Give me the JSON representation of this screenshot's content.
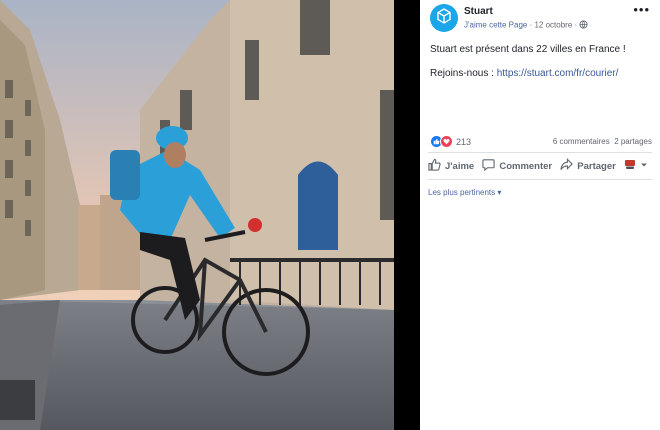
{
  "post": {
    "page_name": "Stuart",
    "like_page": "J'aime cette Page",
    "dot": "·",
    "date": "12 octobre",
    "more": "•••",
    "text": "Stuart est présent dans 22 villes en France !",
    "link_prefix": "Rejoins-nous : ",
    "link_url": "https://stuart.com/fr/courier/"
  },
  "reactions": {
    "count": "213",
    "comments": "6 commentaires",
    "shares": "2 partages"
  },
  "actions": {
    "like": "J'aime",
    "comment": "Commenter",
    "share": "Partager"
  },
  "comments_sort": "Les plus pertinents ▾",
  "colors": {
    "brand": "#1aa6e8",
    "link": "#385898",
    "like_blue": "#1877f2",
    "love_red": "#f33e58"
  },
  "icons": [
    "stuart-logo-icon",
    "globe-icon",
    "like-reaction-icon",
    "love-reaction-icon",
    "thumbs-up-icon",
    "comment-icon",
    "share-icon",
    "audience-icon",
    "caret-down-icon"
  ]
}
